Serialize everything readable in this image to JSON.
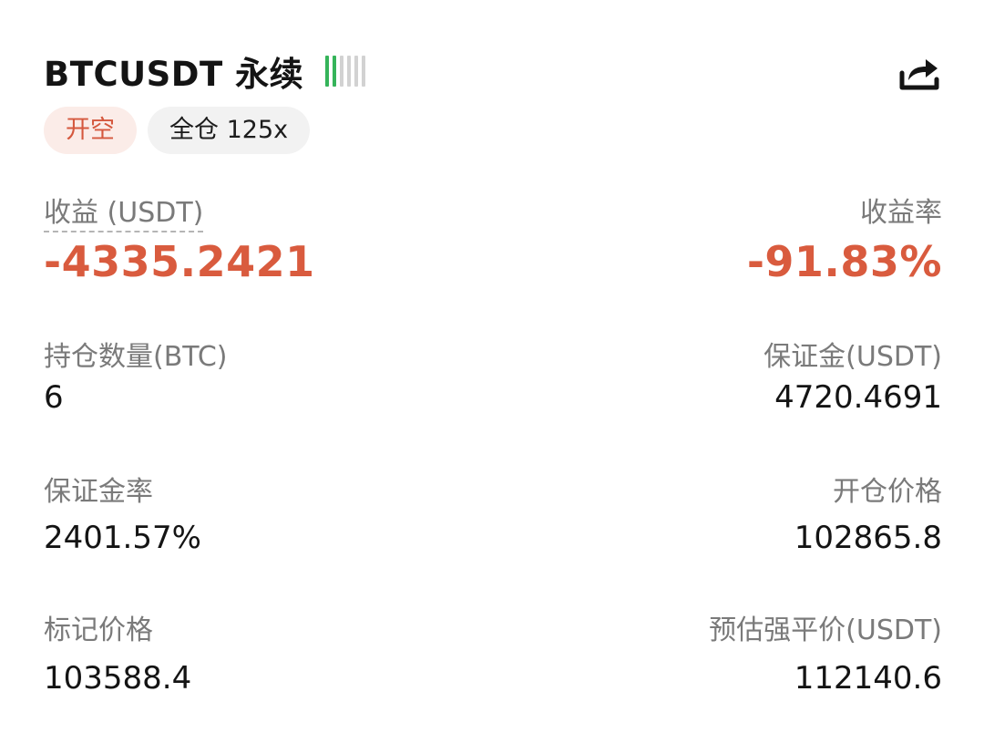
{
  "header": {
    "symbol": "BTCUSDT 永续",
    "signal_level": 2,
    "signal_total": 6,
    "share_icon": "share-icon"
  },
  "tags": {
    "side": "开空",
    "mode": "全仓 125x"
  },
  "pnl": {
    "label": "收益 (USDT)",
    "value": "-4335.2421"
  },
  "roi": {
    "label": "收益率",
    "value": "-91.83%"
  },
  "position_qty": {
    "label": "持仓数量(BTC)",
    "value": "6"
  },
  "margin": {
    "label": "保证金(USDT)",
    "value": "4720.4691"
  },
  "margin_ratio": {
    "label": "保证金率",
    "value": "2401.57%"
  },
  "entry_price": {
    "label": "开仓价格",
    "value": "102865.8"
  },
  "mark_price": {
    "label": "标记价格",
    "value": "103588.4"
  },
  "liq_price": {
    "label": "预估强平价(USDT)",
    "value": "112140.6"
  },
  "colors": {
    "loss": "#d95b3e",
    "signal_on": "#35b45a",
    "signal_off": "#d2d2d2"
  }
}
